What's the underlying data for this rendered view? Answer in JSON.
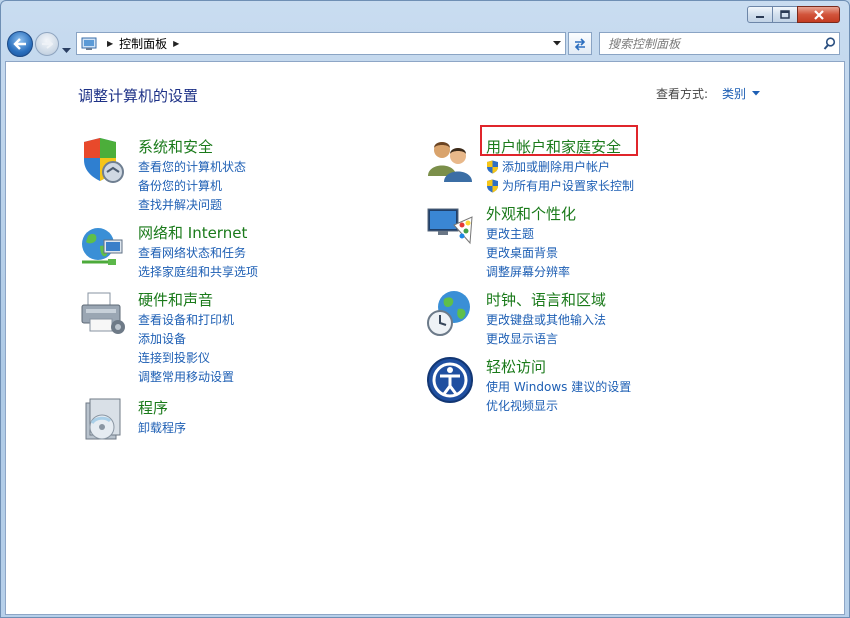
{
  "window": {
    "caption": {
      "minimize_icon": "minimize-icon",
      "maximize_icon": "maximize-icon",
      "close_icon": "close-icon"
    }
  },
  "nav": {
    "address_root_icon": "control-panel-icon",
    "address_segment": "控制面板",
    "search_placeholder": "搜索控制面板"
  },
  "main": {
    "heading": "调整计算机的设置",
    "view_by_label": "查看方式:",
    "view_by_value": "类别",
    "categories": [
      {
        "icon": "shield-security-icon",
        "title": "系统和安全",
        "links": [
          "查看您的计算机状态",
          "备份您的计算机",
          "查找并解决问题"
        ]
      },
      {
        "icon": "network-globe-icon",
        "title": "网络和 Internet",
        "links": [
          "查看网络状态和任务",
          "选择家庭组和共享选项"
        ]
      },
      {
        "icon": "printer-hardware-icon",
        "title": "硬件和声音",
        "links": [
          "查看设备和打印机",
          "添加设备",
          "连接到投影仪",
          "调整常用移动设置"
        ]
      },
      {
        "icon": "programs-disc-icon",
        "title": "程序",
        "links": [
          "卸载程序"
        ]
      },
      {
        "icon": "users-icon",
        "title": "用户帐户和家庭安全",
        "links": [
          "添加或删除用户帐户",
          "为所有用户设置家长控制"
        ]
      },
      {
        "icon": "monitor-palette-icon",
        "title": "外观和个性化",
        "links": [
          "更改主题",
          "更改桌面背景",
          "调整屏幕分辨率"
        ]
      },
      {
        "icon": "clock-globe-icon",
        "title": "时钟、语言和区域",
        "links": [
          "更改键盘或其他输入法",
          "更改显示语言"
        ]
      },
      {
        "icon": "ease-of-access-icon",
        "title": "轻松访问",
        "links": [
          "使用 Windows 建议的设置",
          "优化视频显示"
        ]
      }
    ]
  },
  "colors": {
    "category_title": "#1a7a1a",
    "link": "#1e5fb4",
    "heading": "#1e3287",
    "highlight": "#e0252b"
  }
}
